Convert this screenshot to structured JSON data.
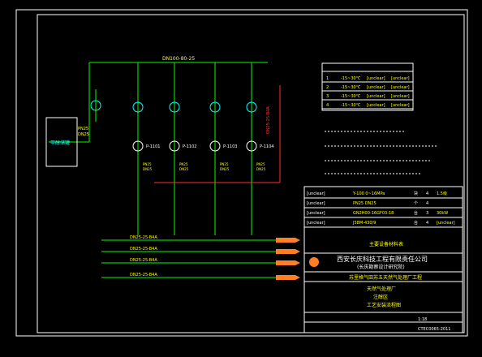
{
  "drawing": {
    "main_header": "DN100-80-25",
    "title_block": {
      "company": "西安长庆科技工程有限责任公司",
      "company_sub": "(长庆勘察设计研究院)",
      "project": "苏里格气田苏五天然气处理厂工程",
      "drawing_title_1": "天然气处理厂",
      "drawing_title_2": "注醇区",
      "drawing_title_3": "工艺安装流程图",
      "scale": "1:18",
      "drawing_no": "CTEC0065-2011"
    },
    "equipment_table_title": "主要设备材料表",
    "equipment_rows": [
      {
        "item": "[unclear]",
        "spec": "Y-100 0~16MPa",
        "unit": "块",
        "qty": "4",
        "note": "1.5级"
      },
      {
        "item": "[unclear]",
        "spec": "PN25 DN25",
        "unit": "个",
        "qty": "4",
        "note": ""
      },
      {
        "item": "[unclear]",
        "spec": "GN2H00-16GF03-18",
        "unit": "台",
        "qty": "3",
        "note": "30kW"
      },
      {
        "item": "[unclear]",
        "spec": "J58M-430/9",
        "unit": "台",
        "qty": "4",
        "note": "[unclear]"
      }
    ],
    "pipe_legend_rows": [
      {
        "no": "1",
        "temp": "-15~30℃",
        "press": "[unclear]",
        "flow": "[unclear]"
      },
      {
        "no": "2",
        "temp": "-15~30℃",
        "press": "[unclear]",
        "flow": "[unclear]"
      },
      {
        "no": "3",
        "temp": "-15~30℃",
        "press": "[unclear]",
        "flow": "[unclear]"
      },
      {
        "no": "4",
        "temp": "-15~30℃",
        "press": "[unclear]",
        "flow": "[unclear]"
      }
    ],
    "tank_label": "甲醇储罐",
    "pump_tags": [
      "P-1101",
      "P-1102",
      "P-1103",
      "P-1104"
    ],
    "header_lines": [
      "DN25-25-B4A",
      "DN25-25-B4A",
      "DN25-25-B4A",
      "DN25-25-B4A"
    ],
    "valve_tags": [
      "PN25",
      "DN25"
    ],
    "colors": {
      "frame": "#ffffff",
      "pipe_green": "#00ff00",
      "pipe_red": "#ff3030",
      "text_yellow": "#ffff00",
      "text_cyan": "#00ffff",
      "text_white": "#ffffff",
      "arrow_orange": "#ff7f27"
    }
  }
}
